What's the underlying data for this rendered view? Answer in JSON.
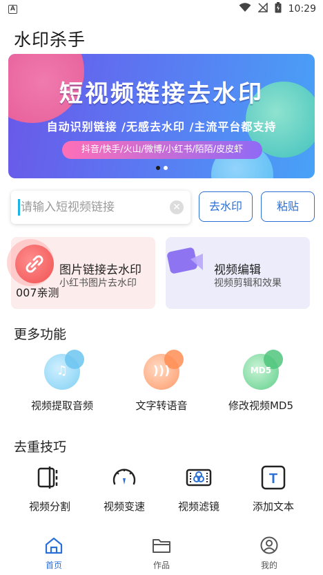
{
  "status_bar": {
    "time": "10:29",
    "left_icon": "a-notification-icon",
    "icons": [
      "wifi-icon",
      "no-signal-icon",
      "battery-icon"
    ]
  },
  "app": {
    "title": "水印杀手"
  },
  "banner": {
    "headline": "短视频链接去水印",
    "subline": "自动识别链接 /无感去水印 /主流平台都支持",
    "platforms": "抖音/快手/火山/微博/小红书/陌陌/皮皮虾"
  },
  "search": {
    "placeholder": "请输入短视频链接",
    "value": "",
    "remove_button": "去水印",
    "paste_button": "粘贴"
  },
  "cards": {
    "image_link": {
      "title": "图片链接去水印",
      "subtitle": "小红书图片去水印",
      "overlay_text": "007亲测"
    },
    "video_edit": {
      "title": "视频编辑",
      "subtitle": "视频剪辑和效果"
    }
  },
  "more_features": {
    "title": "更多功能",
    "items": [
      {
        "label": "视频提取音频",
        "icon": "music-note-icon"
      },
      {
        "label": "文字转语音",
        "icon": "sound-wave-icon"
      },
      {
        "label": "修改视频MD5",
        "icon": "md5-icon",
        "icon_text": "MD5"
      }
    ]
  },
  "tips": {
    "title": "去重技巧",
    "items": [
      {
        "label": "视频分割",
        "icon": "split-icon"
      },
      {
        "label": "视频变速",
        "icon": "speedometer-icon"
      },
      {
        "label": "视频滤镜",
        "icon": "filter-icon"
      },
      {
        "label": "添加文本",
        "icon": "text-icon",
        "icon_text": "T"
      }
    ]
  },
  "bottom_nav": {
    "items": [
      {
        "label": "首页",
        "icon": "home-icon",
        "active": true
      },
      {
        "label": "作品",
        "icon": "folder-icon",
        "active": false
      },
      {
        "label": "我的",
        "icon": "user-icon",
        "active": false
      }
    ]
  },
  "colors": {
    "accent": "#2a6fd6",
    "banner_start": "#6a57e8",
    "banner_end": "#48a2f6",
    "card_left_bg": "#fdecec",
    "card_right_bg": "#ececfb"
  }
}
